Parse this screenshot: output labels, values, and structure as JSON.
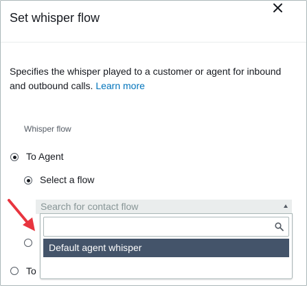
{
  "dialog": {
    "title": "Set whisper flow",
    "description": "Specifies the whisper played to a customer or agent for inbound and outbound calls.",
    "learn_more": "Learn more"
  },
  "whisper": {
    "section_label": "Whisper flow",
    "to_agent_label": "To Agent",
    "select_flow_label": "Select a flow",
    "to_customer_label_partial": "To",
    "to_agent_selected": true,
    "select_flow_selected": true
  },
  "flow_select": {
    "placeholder": "Search for contact flow",
    "search_value": "",
    "options": [
      "Default agent whisper"
    ],
    "highlighted_option": "Default agent whisper"
  },
  "colors": {
    "accent_link": "#0073bb",
    "highlight": "#44546a",
    "annotation_arrow": "#e8353f"
  },
  "icons": {
    "close": "close-icon",
    "search": "search-icon",
    "caret": "caret-up-icon",
    "annotation": "red-arrow-icon"
  }
}
